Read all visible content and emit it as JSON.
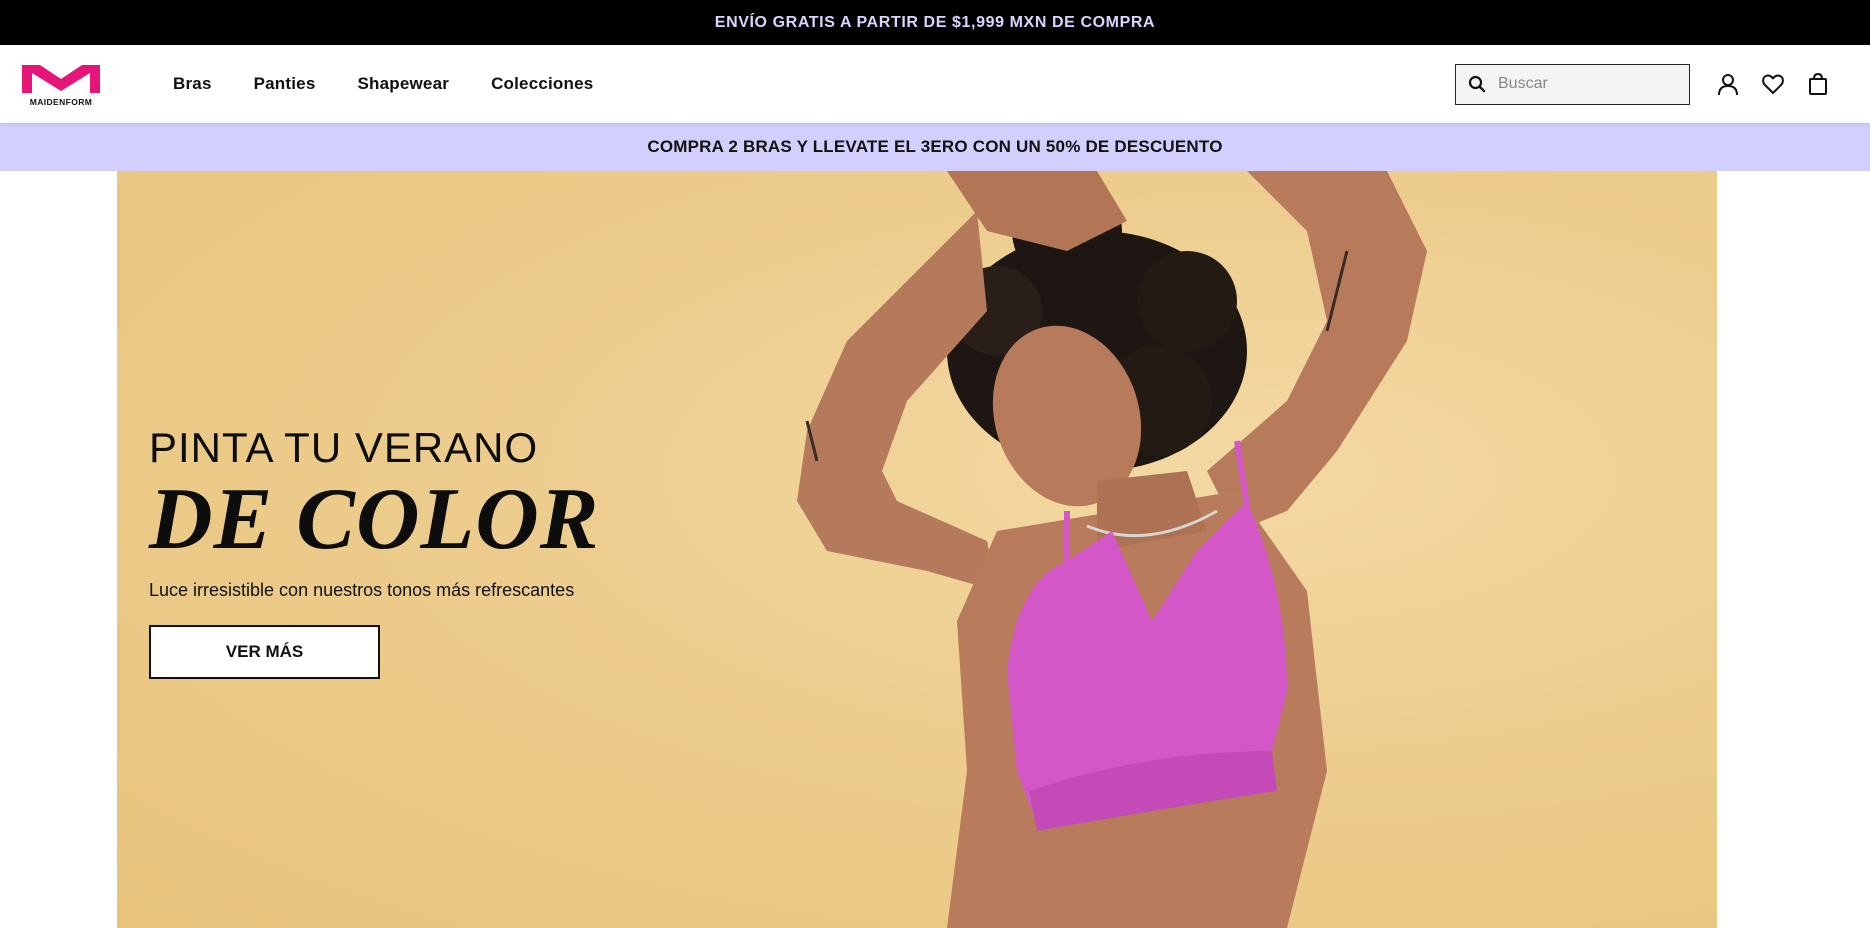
{
  "topbar": {
    "text": "ENVÍO GRATIS A PARTIR DE $1,999 MXN DE COMPRA"
  },
  "header": {
    "logo_text": "MAIDENFORM",
    "nav": [
      "Bras",
      "Panties",
      "Shapewear",
      "Colecciones"
    ],
    "search_placeholder": "Buscar",
    "icons": [
      "search-icon",
      "account-icon",
      "wishlist-heart-icon",
      "shopping-bag-icon"
    ],
    "brand_color": "#e5157a"
  },
  "promo": {
    "text": "COMPRA 2 BRAS Y LLEVATE EL 3ERO CON UN 50% DE DESCUENTO",
    "background": "#d3cffd"
  },
  "hero": {
    "title_line1": "PINTA TU VERANO",
    "title_line2": "DE COLOR",
    "subtitle": "Luce irresistible con nuestros tonos más refrescantes",
    "cta_label": "VER MÁS",
    "background": "#edcd8e"
  }
}
